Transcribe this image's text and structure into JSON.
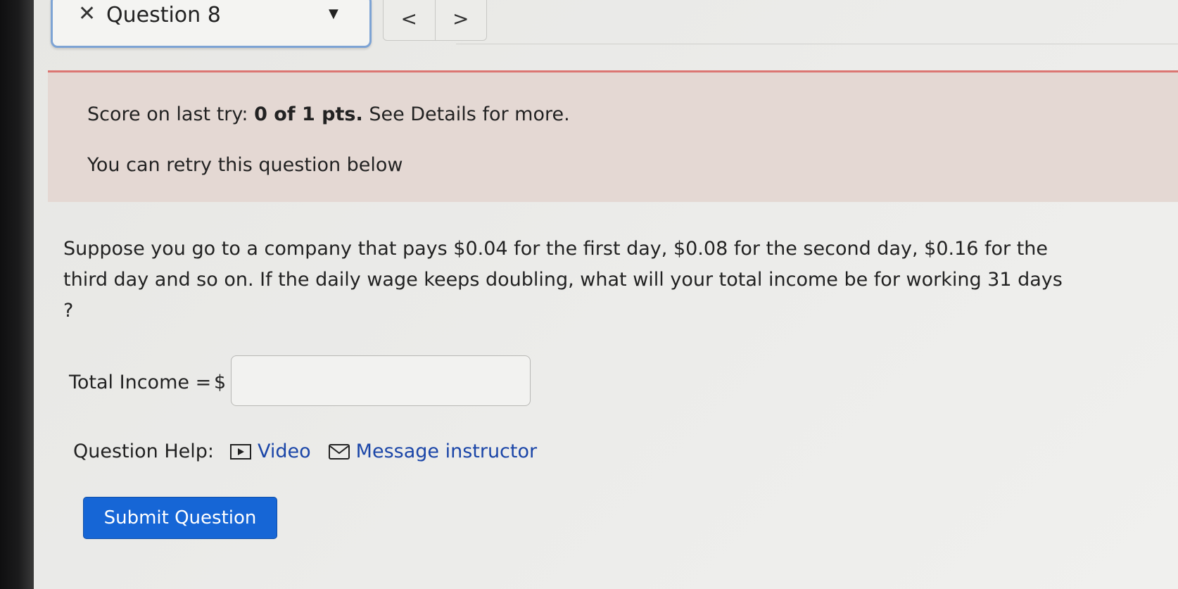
{
  "header": {
    "close_symbol": "✕",
    "question_title": "Question 8",
    "dropdown_caret": "▼",
    "prev_symbol": "<",
    "next_symbol": ">"
  },
  "alert": {
    "score_prefix": "Score on last try: ",
    "score_value": "0 of 1 pts.",
    "score_suffix": " See Details for more.",
    "retry_text": "You can retry this question below"
  },
  "question": {
    "text": "Suppose you go to a company that pays $0.04 for the first day, $0.08 for the second day, $0.16 for the third day and so on. If the daily wage keeps doubling, what will your total income be for working 31 days ?",
    "answer_label": "Total Income =",
    "currency_symbol": "$",
    "answer_value": ""
  },
  "help": {
    "label": "Question Help:",
    "video_label": "Video",
    "message_label": "Message instructor"
  },
  "actions": {
    "submit_label": "Submit Question"
  },
  "colors": {
    "accent": "#1666d6",
    "link": "#1b46a8",
    "alert_border": "#db7672",
    "alert_bg": "#e4d8d3",
    "select_border": "#7da3d4"
  },
  "icons": {
    "close": "close-icon",
    "dropdown": "caret-down-icon",
    "prev": "chevron-left-icon",
    "next": "chevron-right-icon",
    "video": "video-play-icon",
    "message": "envelope-icon"
  }
}
